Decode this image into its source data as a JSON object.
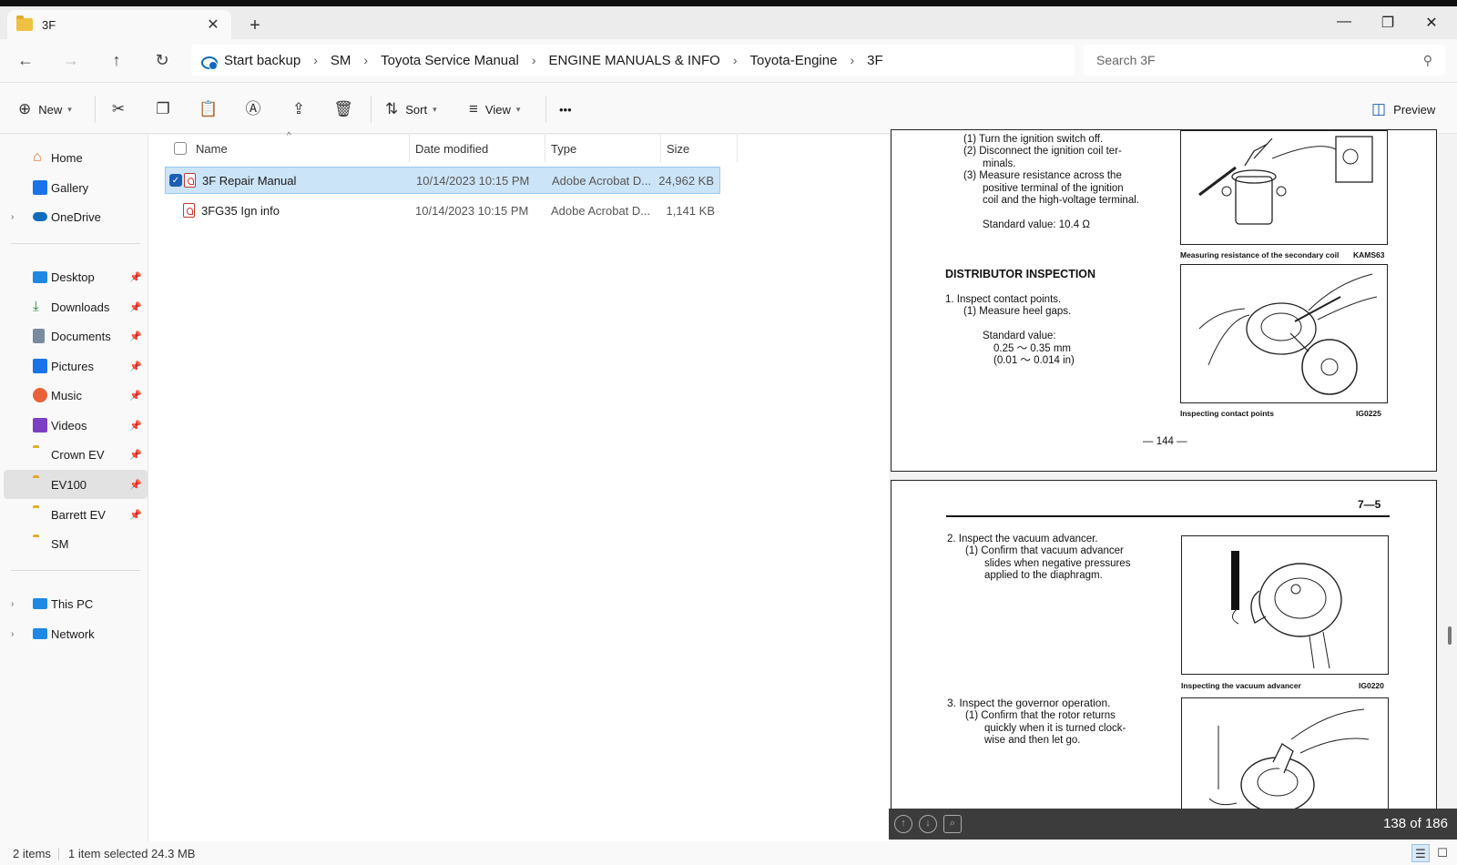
{
  "window": {
    "tab_title": "3F",
    "new_tab": "+",
    "minimize": "—",
    "restore": "❐",
    "close": "✕"
  },
  "nav": {
    "back": "←",
    "forward": "→",
    "up": "↑",
    "refresh": "↻",
    "breadcrumbs": [
      "Start backup",
      "SM",
      "Toyota Service Manual",
      "ENGINE MANUALS & INFO",
      "Toyota-Engine",
      "3F"
    ],
    "separator": "›",
    "search_placeholder": "Search 3F",
    "search_icon": "⚲"
  },
  "commands": {
    "new_label": "New",
    "sort_label": "Sort",
    "view_label": "View",
    "more": "•••",
    "preview_label": "Preview"
  },
  "sidebar": {
    "items": [
      {
        "label": "Home",
        "icon": "home-icon",
        "color": "#e06a2b"
      },
      {
        "label": "Gallery",
        "icon": "gallery-icon",
        "color": "#1a73e8"
      },
      {
        "label": "OneDrive",
        "icon": "onedrive-icon",
        "color": "#0f6cbd"
      },
      {
        "label": "Desktop",
        "icon": "desktop-icon",
        "color": "#1e88e5"
      },
      {
        "label": "Downloads",
        "icon": "downloads-icon",
        "color": "#188038"
      },
      {
        "label": "Documents",
        "icon": "documents-icon",
        "color": "#7a8ba0"
      },
      {
        "label": "Pictures",
        "icon": "pictures-icon",
        "color": "#1a73e8"
      },
      {
        "label": "Music",
        "icon": "music-icon",
        "color": "#e8613b"
      },
      {
        "label": "Videos",
        "icon": "videos-icon",
        "color": "#7b3fc4"
      },
      {
        "label": "Crown EV",
        "icon": "folder-icon",
        "color": "#f2c13e"
      },
      {
        "label": "EV100",
        "icon": "folder-icon",
        "color": "#f2c13e"
      },
      {
        "label": "Barrett EV",
        "icon": "folder-icon",
        "color": "#f2c13e"
      },
      {
        "label": "SM",
        "icon": "folder-icon",
        "color": "#f2c13e"
      },
      {
        "label": "This PC",
        "icon": "pc-icon",
        "color": "#1e88e5"
      },
      {
        "label": "Network",
        "icon": "network-icon",
        "color": "#1e88e5"
      }
    ]
  },
  "files": {
    "columns": [
      "Name",
      "Date modified",
      "Type",
      "Size"
    ],
    "rows": [
      {
        "name": "3F Repair Manual",
        "date": "10/14/2023 10:15 PM",
        "type": "Adobe Acrobat D...",
        "size": "24,962 KB",
        "selected": true
      },
      {
        "name": "3FG35 Ign info",
        "date": "10/14/2023 10:15 PM",
        "type": "Adobe Acrobat D...",
        "size": "1,141 KB",
        "selected": false
      }
    ]
  },
  "preview": {
    "page1": {
      "step1": "(1)  Turn the ignition switch off.",
      "step2a": "(2)  Disconnect the ignition coil ter-",
      "step2b": "minals.",
      "step3a": "(3)  Measure  resistance  across  the",
      "step3b": "positive  terminal  of  the  ignition",
      "step3c": "coil and the high-voltage terminal.",
      "std1": "Standard value:    10.4 Ω",
      "cap1": "Measuring resistance of the secondary coil",
      "code1": "KAMS63",
      "heading": "DISTRIBUTOR INSPECTION",
      "insp1": "1.   Inspect contact points.",
      "insp1a": "(1)  Measure heel gaps.",
      "std2": "Standard value:",
      "std2a": "0.25 〜 0.35 mm",
      "std2b": "(0.01 〜 0.014 in)",
      "cap2": "Inspecting contact points",
      "code2": "IG0225",
      "page_no": "— 144 —"
    },
    "page2": {
      "section": "7—5",
      "insp2": "2.   Inspect the vacuum advancer.",
      "insp2a": "(1)  Confirm  that  vacuum  advancer",
      "insp2b": "slides  when  negative  pressures",
      "insp2c": "applied to the diaphragm.",
      "cap3": "Inspecting the vacuum advancer",
      "code3": "IG0220",
      "insp3": "3.   Inspect the governor operation.",
      "insp3a": "(1)  Confirm  that  the  rotor  returns",
      "insp3b": "quickly  when  it  is  turned  clock-",
      "insp3c": "wise and then let go."
    },
    "page_counter": "138 of 186"
  },
  "status": {
    "item_count": "2 items",
    "selection": "1 item selected  24.3 MB"
  }
}
